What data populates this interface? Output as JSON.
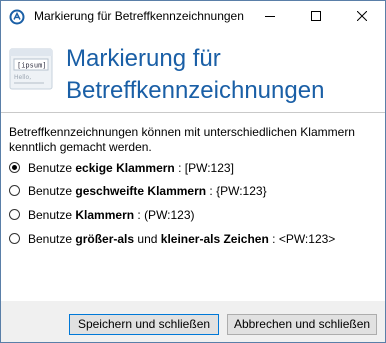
{
  "window": {
    "title": "Markierung für Betreffkennzeichnungen",
    "app_icon": "a-circle-icon",
    "controls": [
      "minimize-icon",
      "maximize-icon",
      "close-icon"
    ]
  },
  "header": {
    "logo_icon": "placeholder-bubble-icon",
    "logo_text_1": "[ipsum]",
    "logo_text_2": "Hello,",
    "title_line1": "Markierung für",
    "title_line2": "Betreffkennzeichnungen"
  },
  "description": "Betreffkennzeichnungen können mit unterschiedlichen Klammern kenntlich gemacht werden.",
  "options": [
    {
      "prefix": "Benutze ",
      "bold": "eckige Klammern",
      "mid": "",
      "bold2": "",
      "suffix": " : [PW:123]",
      "checked": true
    },
    {
      "prefix": "Benutze ",
      "bold": "geschweifte Klammern",
      "mid": "",
      "bold2": "",
      "suffix": " : {PW:123}",
      "checked": false
    },
    {
      "prefix": "Benutze ",
      "bold": "Klammern",
      "mid": "",
      "bold2": "",
      "suffix": " : (PW:123)",
      "checked": false
    },
    {
      "prefix": "Benutze ",
      "bold": "größer-als",
      "mid": " und ",
      "bold2": "kleiner-als Zeichen",
      "suffix": " : <PW:123>",
      "checked": false
    }
  ],
  "buttons": {
    "save": "Speichern und schließen",
    "cancel": "Abbrechen und schließen"
  },
  "colors": {
    "accent": "#1a5fa6",
    "border": "#5a7fa8",
    "footer": "#f0f0f0"
  }
}
